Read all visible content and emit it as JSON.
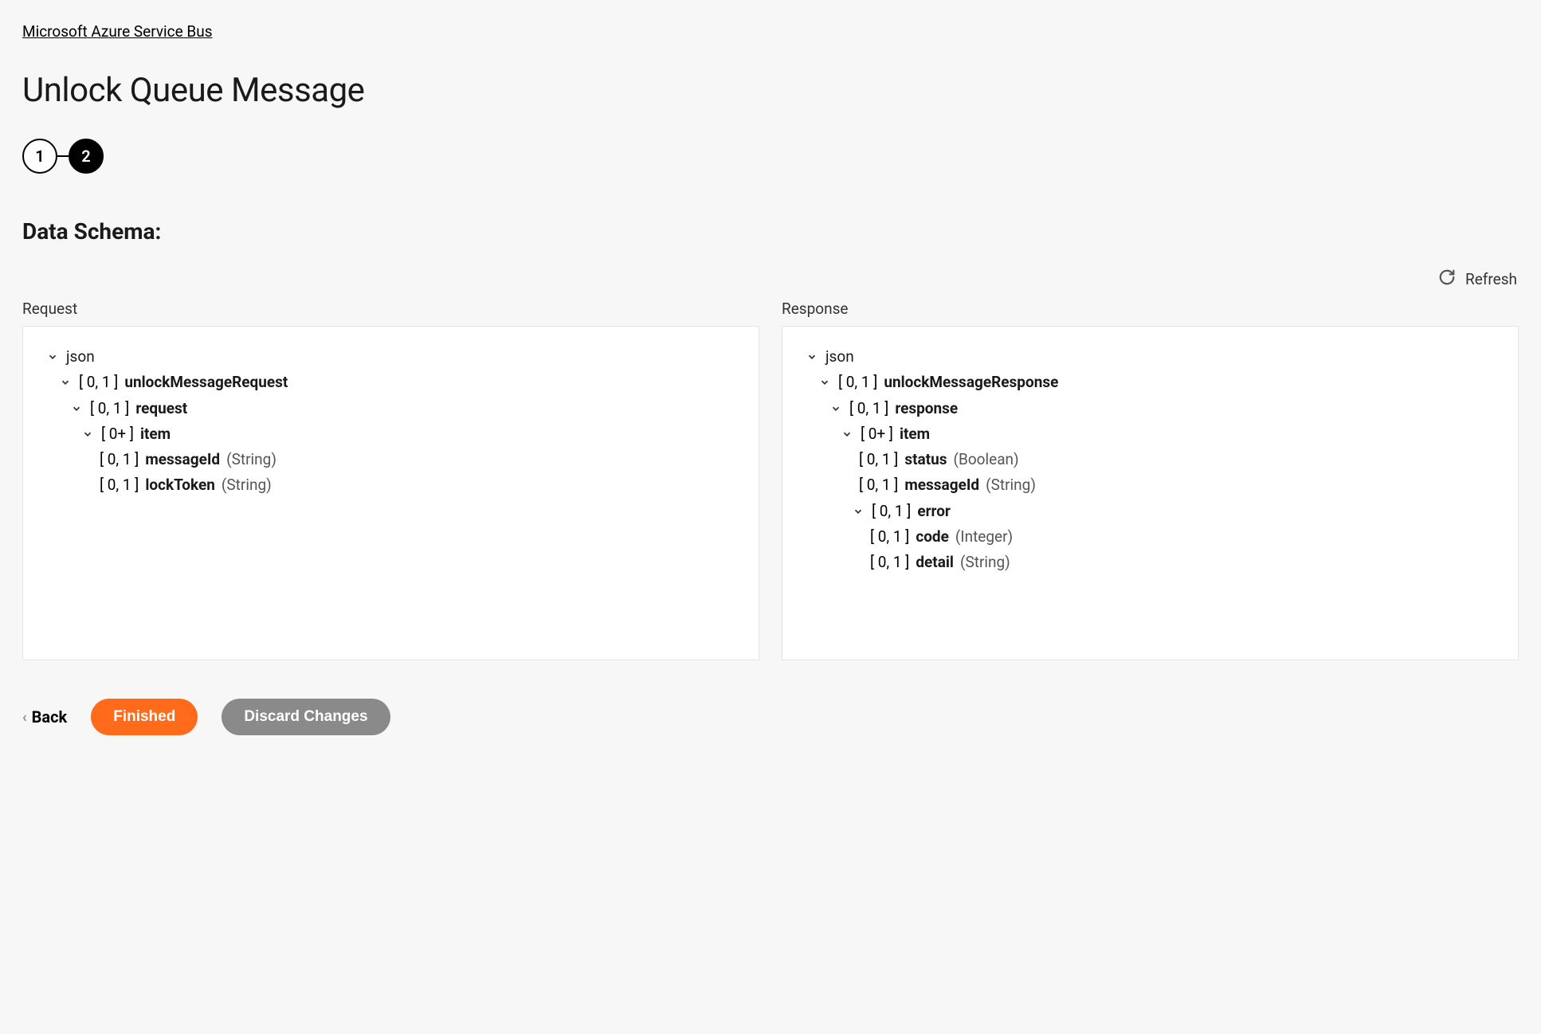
{
  "breadcrumb": "Microsoft Azure Service Bus",
  "title": "Unlock Queue Message",
  "stepper": {
    "step1": "1",
    "step2": "2"
  },
  "section_title": "Data Schema:",
  "refresh_label": "Refresh",
  "panels": {
    "request_label": "Request",
    "response_label": "Response"
  },
  "request_tree": {
    "root": "json",
    "l1": {
      "card": "[ 0, 1 ]",
      "name": "unlockMessageRequest"
    },
    "l2": {
      "card": "[ 0, 1 ]",
      "name": "request"
    },
    "l3": {
      "card": "[ 0+ ]",
      "name": "item"
    },
    "f1": {
      "card": "[ 0, 1 ]",
      "name": "messageId",
      "type": "(String)"
    },
    "f2": {
      "card": "[ 0, 1 ]",
      "name": "lockToken",
      "type": "(String)"
    }
  },
  "response_tree": {
    "root": "json",
    "l1": {
      "card": "[ 0, 1 ]",
      "name": "unlockMessageResponse"
    },
    "l2": {
      "card": "[ 0, 1 ]",
      "name": "response"
    },
    "l3": {
      "card": "[ 0+ ]",
      "name": "item"
    },
    "f1": {
      "card": "[ 0, 1 ]",
      "name": "status",
      "type": "(Boolean)"
    },
    "f2": {
      "card": "[ 0, 1 ]",
      "name": "messageId",
      "type": "(String)"
    },
    "l4": {
      "card": "[ 0, 1 ]",
      "name": "error"
    },
    "f3": {
      "card": "[ 0, 1 ]",
      "name": "code",
      "type": "(Integer)"
    },
    "f4": {
      "card": "[ 0, 1 ]",
      "name": "detail",
      "type": "(String)"
    }
  },
  "footer": {
    "back": "Back",
    "finished": "Finished",
    "discard": "Discard Changes"
  }
}
